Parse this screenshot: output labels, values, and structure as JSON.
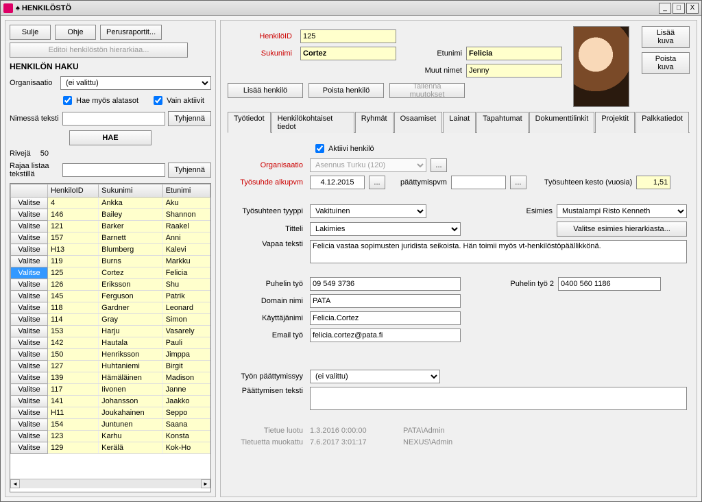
{
  "window": {
    "title": "♠ HENKILÖSTÖ"
  },
  "winbtns": {
    "min": "_",
    "max": "□",
    "close": "X"
  },
  "left": {
    "btn_close": "Sulje",
    "btn_help": "Ohje",
    "btn_reports": "Perusraportit...",
    "btn_edit_hierarchy": "Editoi henkilöstön hierarkiaa...",
    "section": "HENKILÖN HAKU",
    "lbl_org": "Organisaatio",
    "org_value": "(ei valittu)",
    "chk_sub": "Hae myös alatasot",
    "chk_active": "Vain aktiivit",
    "lbl_name": "Nimessä teksti",
    "btn_clear": "Tyhjennä",
    "btn_search": "HAE",
    "lbl_rows": "Rivejä",
    "rows_val": "50",
    "lbl_filter": "Rajaa listaa tekstillä",
    "btn_clear2": "Tyhjennä",
    "cols": {
      "id": "HenkiloID",
      "last": "Sukunimi",
      "first": "Etunimi"
    },
    "select_label": "Valitse",
    "rows": [
      {
        "id": "4",
        "last": "Ankka",
        "first": "Aku"
      },
      {
        "id": "146",
        "last": "Bailey",
        "first": "Shannon"
      },
      {
        "id": "121",
        "last": "Barker",
        "first": "Raakel"
      },
      {
        "id": "157",
        "last": "Barnett",
        "first": "Anni"
      },
      {
        "id": "H13",
        "last": "Blumberg",
        "first": "Kalevi"
      },
      {
        "id": "119",
        "last": "Burns",
        "first": "Markku"
      },
      {
        "id": "125",
        "last": "Cortez",
        "first": "Felicia",
        "sel": true
      },
      {
        "id": "126",
        "last": "Eriksson",
        "first": "Shu"
      },
      {
        "id": "145",
        "last": "Ferguson",
        "first": "Patrik"
      },
      {
        "id": "118",
        "last": "Gardner",
        "first": "Leonard"
      },
      {
        "id": "114",
        "last": "Gray",
        "first": "Simon"
      },
      {
        "id": "153",
        "last": "Harju",
        "first": "Vasarely"
      },
      {
        "id": "142",
        "last": "Hautala",
        "first": "Pauli"
      },
      {
        "id": "150",
        "last": "Henriksson",
        "first": "Jimppa"
      },
      {
        "id": "127",
        "last": "Huhtaniemi",
        "first": "Birgit"
      },
      {
        "id": "139",
        "last": "Hämäläinen",
        "first": "Madison"
      },
      {
        "id": "117",
        "last": "Iivonen",
        "first": "Janne"
      },
      {
        "id": "141",
        "last": "Johansson",
        "first": "Jaakko"
      },
      {
        "id": "H11",
        "last": "Joukahainen",
        "first": "Seppo"
      },
      {
        "id": "154",
        "last": "Juntunen",
        "first": "Saana"
      },
      {
        "id": "123",
        "last": "Karhu",
        "first": "Konsta"
      },
      {
        "id": "129",
        "last": "Kerälä",
        "first": "Kok-Ho"
      }
    ]
  },
  "head": {
    "lbl_id": "HenkilöID",
    "id": "125",
    "lbl_last": "Sukunimi",
    "last": "Cortez",
    "lbl_first": "Etunimi",
    "first": "Felicia",
    "lbl_other": "Muut nimet",
    "other": "Jenny",
    "btn_addimg": "Lisää kuva",
    "btn_delimg": "Poista kuva",
    "btn_add": "Lisää henkilö",
    "btn_del": "Poista henkilö",
    "btn_save": "Tallenna muutokset"
  },
  "tabs": [
    "Työtiedot",
    "Henkilökohtaiset tiedot",
    "Ryhmät",
    "Osaamiset",
    "Lainat",
    "Tapahtumat",
    "Dokumenttilinkit",
    "Projektit",
    "Palkkatiedot"
  ],
  "form": {
    "chk_active": "Aktiivi henkilö",
    "lbl_org": "Organisaatio",
    "org": "Asennus Turku (120)",
    "dots": "...",
    "lbl_start": "Työsuhde alkupvm",
    "start": "4.12.2015",
    "lbl_end": "päättymispvm",
    "end": "",
    "lbl_dur": "Työsuhteen kesto (vuosia)",
    "dur": "1,51",
    "lbl_type": "Työsuhteen tyyppi",
    "type": "Vakituinen",
    "lbl_title": "Titteli",
    "title": "Lakimies",
    "lbl_boss": "Esimies",
    "boss": "Mustalampi Risto Kenneth",
    "btn_bosshier": "Valitse esimies hierarkiasta...",
    "lbl_free": "Vapaa teksti",
    "free": "Felicia vastaa sopimusten juridista seikoista. Hän toimii myös vt-henkilöstöpäällikkönä.",
    "lbl_phone1": "Puhelin työ",
    "phone1": "09 549 3736",
    "lbl_phone2": "Puhelin työ 2",
    "phone2": "0400 560 1186",
    "lbl_domain": "Domain nimi",
    "domain": "PATA",
    "lbl_user": "Käyttäjänimi",
    "user": "Felicia.Cortez",
    "lbl_email": "Email työ",
    "email": "felicia.cortez@pata.fi",
    "lbl_endreason": "Työn päättymissyy",
    "endreason": "(ei valittu)",
    "lbl_endtext": "Päättymisen teksti",
    "endtext": ""
  },
  "footer": {
    "lbl_created": "Tietue luotu",
    "created": "1.3.2016 0:00:00",
    "created_by": "PATA\\Admin",
    "lbl_modified": "Tietuetta muokattu",
    "modified": "7.6.2017 3:01:17",
    "modified_by": "NEXUS\\Admin"
  }
}
